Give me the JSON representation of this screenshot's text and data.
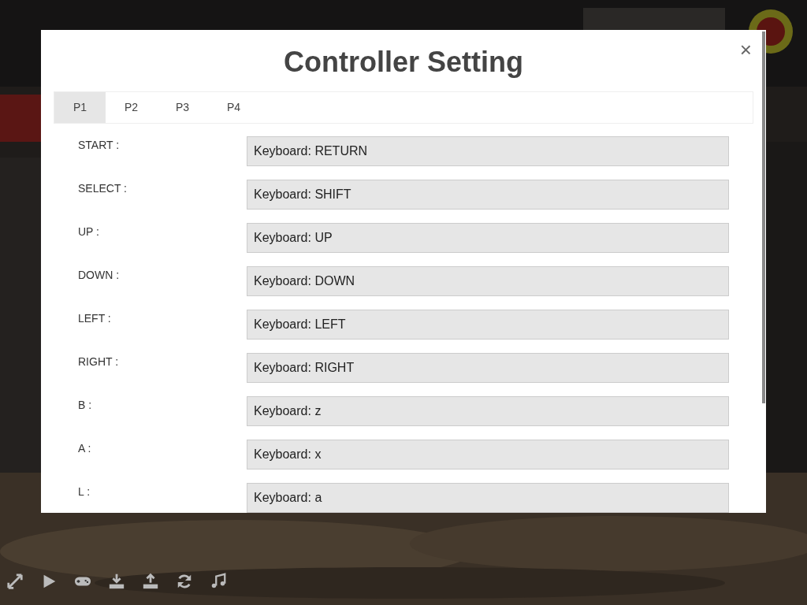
{
  "dialog": {
    "title": "Controller Setting",
    "close": "×"
  },
  "tabs": [
    {
      "label": "P1",
      "selected": true
    },
    {
      "label": "P2",
      "selected": false
    },
    {
      "label": "P3",
      "selected": false
    },
    {
      "label": "P4",
      "selected": false
    }
  ],
  "bindings": [
    {
      "label": "START :",
      "value": "Keyboard: RETURN"
    },
    {
      "label": "SELECT :",
      "value": "Keyboard: SHIFT"
    },
    {
      "label": "UP :",
      "value": "Keyboard: UP"
    },
    {
      "label": "DOWN :",
      "value": "Keyboard: DOWN"
    },
    {
      "label": "LEFT :",
      "value": "Keyboard: LEFT"
    },
    {
      "label": "RIGHT :",
      "value": "Keyboard: RIGHT"
    },
    {
      "label": "B :",
      "value": "Keyboard: z"
    },
    {
      "label": "A :",
      "value": "Keyboard: x"
    },
    {
      "label": "L :",
      "value": "Keyboard: a"
    }
  ],
  "toolbar": [
    {
      "kind": "fullscreen"
    },
    {
      "kind": "play"
    },
    {
      "kind": "gamepad"
    },
    {
      "kind": "download"
    },
    {
      "kind": "upload"
    },
    {
      "kind": "refresh"
    },
    {
      "kind": "music"
    }
  ]
}
